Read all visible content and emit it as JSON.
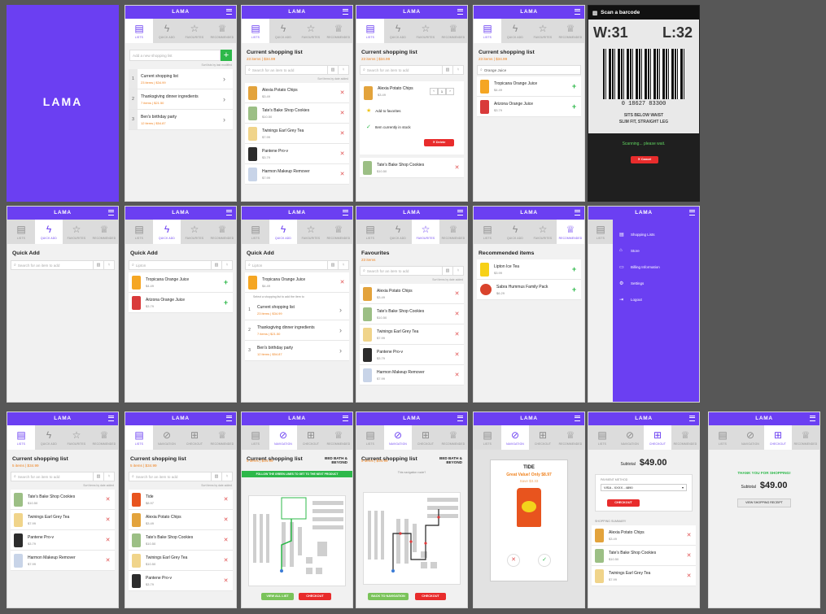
{
  "brand": "LAMA",
  "tabs_main": [
    "Lists",
    "Quick Add",
    "Favourites",
    "Recommended"
  ],
  "tabs_shop": [
    "Lists",
    "Navigation",
    "Checkout",
    "Recommended"
  ],
  "icons": {
    "lists": "document-icon",
    "quick": "bolt-plus-icon",
    "fav": "star-icon",
    "rec": "trophy-icon",
    "nav": "compass-icon",
    "cart": "cart-icon"
  },
  "colors": {
    "brand": "#6b3ff2",
    "accent": "#f0821e",
    "danger": "#e82c2c",
    "success": "#2db84a"
  },
  "lists_screen": {
    "new_placeholder": "Add a new shopping list",
    "sort": "Sort lists by last modified",
    "lists": [
      {
        "num": "1",
        "name": "Current shopping list",
        "meta": "23 items | $34.99"
      },
      {
        "num": "2",
        "name": "Thanksgiving dinner ingredients",
        "meta": "7 items | $21.50"
      },
      {
        "num": "3",
        "name": "Ben's birthday party",
        "meta": "12 items | $54.87"
      }
    ]
  },
  "current": {
    "title": "Current shopping list",
    "meta": "23 items | $34.99",
    "placeholder": "Search for an item to add",
    "sort": "Sort items by date added",
    "items": [
      {
        "name": "Alexia Potato Chips",
        "price": "$3.49"
      },
      {
        "name": "Tate's Bake Shop Cookies",
        "price": "$10.50"
      },
      {
        "name": "Twinings Earl Grey Tea",
        "price": "$7.99"
      },
      {
        "name": "Pantene Pro-v",
        "price": "$3.79"
      },
      {
        "name": "Harmon Makeup Remover",
        "price": "$7.99"
      }
    ]
  },
  "expanded": {
    "item": "Alexia Potato Chips",
    "price": "$3.49",
    "qty": "1",
    "fav": "Add to favorites",
    "stock": "Item currently in stock",
    "delete": "✕ Delete",
    "next": "Tate's Bake Shop Cookies",
    "next_price": "$10.50"
  },
  "search_oj": {
    "query": "Orange Juice",
    "results": [
      {
        "name": "Tropicana Orange Juice",
        "price": "$4.49"
      },
      {
        "name": "Arizona Orange Juice",
        "price": "$3.79"
      }
    ]
  },
  "scanner": {
    "title": "Scan a barcode",
    "code_left": "W:31",
    "code_right": "L:32",
    "number": "0 18627 83300",
    "line1": "SITS BELOW WAIST",
    "line2": "SLIM FIT, STRAIGHT LEG",
    "status": "Scanning... please wait.",
    "cancel": "✕ Cancel"
  },
  "quick_add": {
    "title": "Quick Add",
    "placeholder": "Search for an item to add",
    "query": "Lipton",
    "results": [
      {
        "name": "Tropicana Orange Juice",
        "price": "$4.49"
      },
      {
        "name": "Arizona Orange Juice",
        "price": "$3.79"
      }
    ],
    "choose": "Select a shopping list to add the item to"
  },
  "favourites": {
    "title": "Favourites",
    "meta": "23 items",
    "placeholder": "Search for an item to add",
    "sort": "Sort items by date added",
    "items": [
      {
        "name": "Alexia Potato Chips",
        "price": "$3.49"
      },
      {
        "name": "Tate's Bake Shop Cookies",
        "price": "$10.50"
      },
      {
        "name": "Twinings Earl Grey Tea",
        "price": "$7.99"
      },
      {
        "name": "Pantene Pro-v",
        "price": "$3.79"
      },
      {
        "name": "Harmon Makeup Remover",
        "price": "$7.99"
      }
    ]
  },
  "recommended": {
    "title": "Recommended items",
    "items": [
      {
        "name": "Lipton Ice Tea",
        "price": "$3.99"
      },
      {
        "name": "Sabra Hummus Family Pack",
        "price": "$6.29"
      }
    ]
  },
  "menu": {
    "items": [
      "Shopping Lists",
      "Store",
      "Billing Information",
      "Settings",
      "Logout"
    ]
  },
  "current5": {
    "title": "Current shopping list",
    "meta": "5 items | $34.99",
    "items": [
      {
        "name": "Tate's Bake Shop Cookies",
        "price": "$10.50"
      },
      {
        "name": "Twinings Earl Grey Tea",
        "price": "$7.99"
      },
      {
        "name": "Pantene Pro-v",
        "price": "$3.79"
      },
      {
        "name": "Harmon Makeup Remover",
        "price": "$7.99"
      }
    ],
    "items2": [
      {
        "name": "Tide",
        "price": "$8.97"
      },
      {
        "name": "Alexia Potato Chips",
        "price": "$3.49"
      },
      {
        "name": "Tate's Bake Shop Cookies",
        "price": "$10.50"
      },
      {
        "name": "Twinings Earl Grey Tea",
        "price": "$10.50"
      },
      {
        "name": "Pantene Pro-v",
        "price": "$3.79"
      }
    ]
  },
  "navigation": {
    "store": "BED BATH & BEYOND",
    "banner": "FOLLOW THE GREEN LINES TO GET TO THE NEXT PRODUCT",
    "next_product": "Alexia Potato Chips",
    "done": "This navigation route?",
    "view_all": "View all list",
    "checkout": "Checkout",
    "back": "Back to navigation"
  },
  "tide_popup": {
    "name": "TIDE",
    "deal": "Great Value! Only $8.97",
    "save": "Save $3.33"
  },
  "checkout": {
    "subtotal_label": "Subtotal",
    "subtotal": "$49.00",
    "payment_label": "PAYMENT METHOD",
    "card": "VISA - XXXX - 4890",
    "pay": "Checkout",
    "summary_label": "SHOPPING SUMMARY",
    "items": [
      {
        "name": "Alexia Potato Chips",
        "price": "$3.49"
      },
      {
        "name": "Tate's Bake Shop Cookies",
        "price": "$10.50"
      },
      {
        "name": "Twinings Earl Grey Tea",
        "price": "$7.99"
      }
    ],
    "thanks": "THANK YOU FOR SHOPPING!",
    "receipt": "View shopping receipt"
  }
}
